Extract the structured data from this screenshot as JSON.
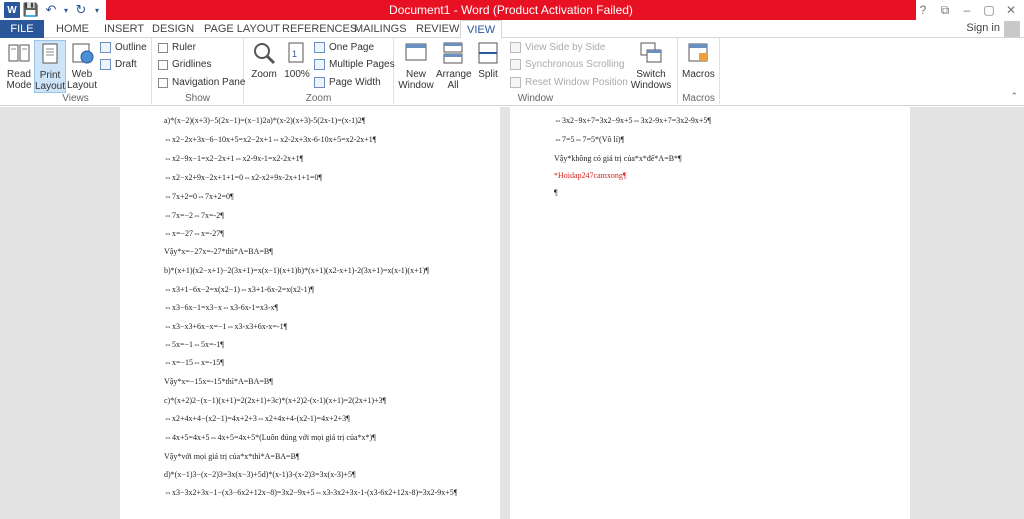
{
  "titlebar": {
    "title": "Document1 - Word (Product Activation Failed)",
    "controls": [
      "?",
      "⧉",
      "–",
      "▢",
      "✕"
    ]
  },
  "tabs": [
    "FILE",
    "HOME",
    "INSERT",
    "DESIGN",
    "PAGE LAYOUT",
    "REFERENCES",
    "MAILINGS",
    "REVIEW",
    "VIEW"
  ],
  "signin": "Sign in",
  "ribbon": {
    "views": {
      "label": "Views",
      "read_mode": "Read Mode",
      "print_layout": "Print Layout",
      "web_layout": "Web Layout",
      "outline": "Outline",
      "draft": "Draft"
    },
    "show": {
      "label": "Show",
      "ruler": "Ruler",
      "gridlines": "Gridlines",
      "navigation_pane": "Navigation Pane"
    },
    "zoom": {
      "label": "Zoom",
      "zoom": "Zoom",
      "hundred": "100%",
      "one_page": "One Page",
      "multiple_pages": "Multiple Pages",
      "page_width": "Page Width"
    },
    "window": {
      "label": "Window",
      "new_window": "New Window",
      "arrange_all": "Arrange All",
      "split": "Split",
      "side_by_side": "View Side by Side",
      "sync_scroll": "Synchronous Scrolling",
      "reset_pos": "Reset Window Position",
      "switch_windows": "Switch Windows"
    },
    "macros": {
      "label": "Macros",
      "macros": "Macros"
    }
  },
  "doc": {
    "page1": [
      "a)*(x−2)(x+3)−5(2x−1)=(x−1)2a)*(x-2)(x+3)-5(2x-1)=(x-1)2¶",
      "⇔x2−2x+3x−6−10x+5=x2−2x+1⇔x2-2x+3x-6-10x+5=x2-2x+1¶",
      "⇔x2−9x−1=x2−2x+1⇔x2-9x-1=x2-2x+1¶",
      "⇔x2−x2+9x−2x+1+1=0⇔x2-x2+9x-2x+1+1=0¶",
      "⇔7x+2=0⇔7x+2=0¶",
      "⇔7x=−2⇔7x=-2¶",
      "⇔x=−27⇔x=-27¶",
      "Vậy*x=−27x=-27*thì*A=BA=B¶",
      "b)*(x+1)(x2−x+1)−2(3x+1)=x(x−1)(x+1)b)*(x+1)(x2-x+1)-2(3x+1)=x(x-1)(x+1)¶",
      "⇔x3+1−6x−2=x(x2−1)⇔x3+1-6x-2=x(x2-1)¶",
      "⇔x3−6x−1=x3−x⇔x3-6x-1=x3-x¶",
      "⇔x3−x3+6x−x=−1⇔x3-x3+6x-x=-1¶",
      "⇔5x=−1⇔5x=-1¶",
      "⇔x=−15⇔x=-15¶",
      "Vậy*x=−15x=-15*thì*A=BA=B¶",
      "c)*(x+2)2−(x−1)(x+1)=2(2x+1)+3c)*(x+2)2-(x-1)(x+1)=2(2x+1)+3¶",
      "⇔x2+4x+4−(x2−1)=4x+2+3⇔x2+4x+4-(x2-1)=4x+2+3¶",
      "⇔4x+5=4x+5⇔4x+5=4x+5*(Luôn đúng với mọi giá trị của*x*)¶",
      "Vậy*với mọi giá trị của*x*thì*A=BA=B¶",
      "d)*(x−1)3−(x−2)3=3x(x−3)+5d)*(x-1)3-(x-2)3=3x(x-3)+5¶",
      "⇔x3−3x2+3x−1−(x3−6x2+12x−8)=3x2−9x+5⇔x3-3x2+3x-1-(x3-6x2+12x-8)=3x2-9x+5¶"
    ],
    "page2": [
      "⇔3x2−9x+7=3x2−9x+5⇔3x2-9x+7=3x2-9x+5¶",
      "⇔7=5⇔7=5*(Vô lí)¶",
      "Vậy*không có giá trị của*x*để*A=B*¶",
      "*Hoidap247camxong¶",
      "¶"
    ]
  }
}
